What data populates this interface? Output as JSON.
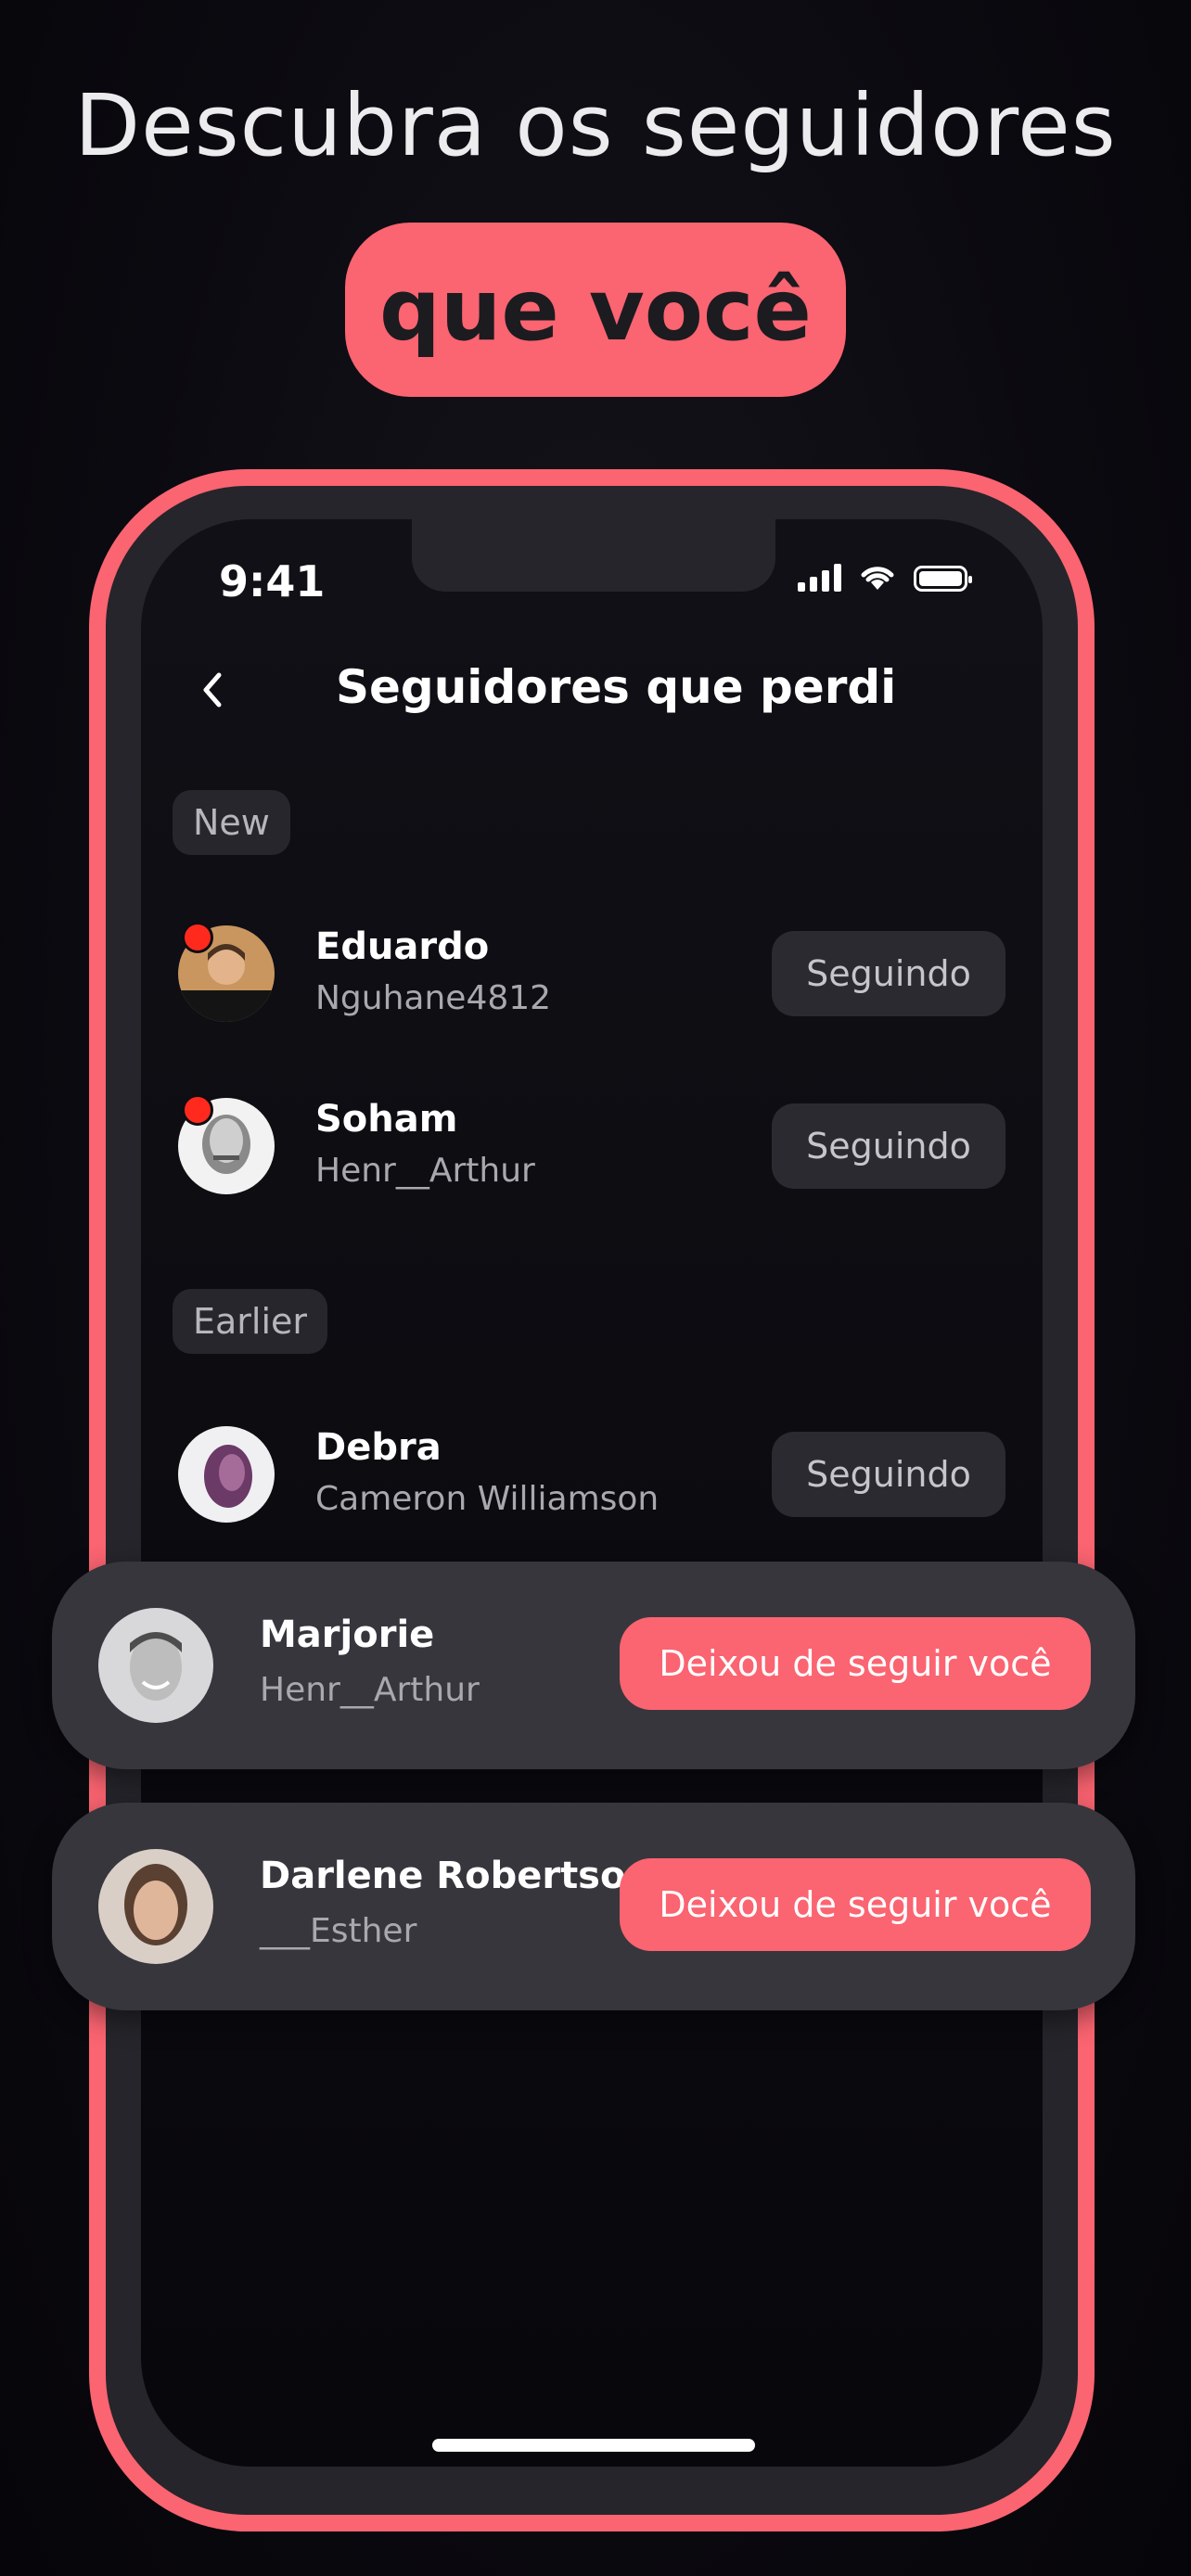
{
  "headline": "Descubra os seguidores",
  "highlight": "que você",
  "status_bar": {
    "time": "9:41"
  },
  "nav": {
    "title": "Seguidores que perdi"
  },
  "sections": {
    "new": "New",
    "earlier": "Earlier"
  },
  "new_followers": [
    {
      "name": "Eduardo",
      "handle": "Nguhane4812",
      "button": "Seguindo",
      "unread": true
    },
    {
      "name": "Soham",
      "handle": "Henr__Arthur",
      "button": "Seguindo",
      "unread": true
    }
  ],
  "earlier_followers": [
    {
      "name": "Debra",
      "handle": "Cameron Williamson",
      "button": "Seguindo"
    }
  ],
  "highlight_cards": [
    {
      "name": "Marjorie",
      "handle": "Henr__Arthur",
      "button": "Deixou de seguir você"
    },
    {
      "name": "Darlene Robertson",
      "handle": "___Esther",
      "button": "Deixou de seguir você"
    }
  ],
  "colors": {
    "accent": "#fb6471",
    "background": "#0b0a10",
    "card": "#37363d",
    "badge_dot": "#ff2a1d"
  }
}
